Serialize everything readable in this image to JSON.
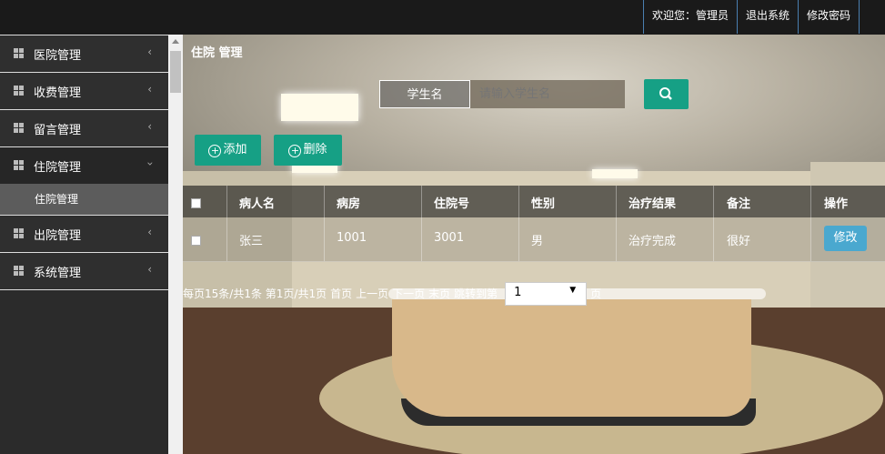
{
  "header": {
    "welcome": "欢迎您：管理员",
    "logout": "退出系统",
    "change_password": "修改密码"
  },
  "sidebar": {
    "items": [
      {
        "label": "医院管理",
        "expanded": false
      },
      {
        "label": "收费管理",
        "expanded": false
      },
      {
        "label": "留言管理",
        "expanded": false
      },
      {
        "label": "住院管理",
        "expanded": true,
        "children": [
          {
            "label": "住院管理"
          }
        ]
      },
      {
        "label": "出院管理",
        "expanded": false
      },
      {
        "label": "系统管理",
        "expanded": false
      }
    ]
  },
  "main": {
    "title": "住院 管理",
    "search": {
      "label": "学生名",
      "placeholder": "请输入学生名",
      "button_icon": "search-icon"
    },
    "actions": {
      "add": "添加",
      "delete": "删除"
    },
    "table": {
      "columns": [
        "病人名",
        "病房",
        "住院号",
        "性别",
        "治疗结果",
        "备注",
        "操作"
      ],
      "rows": [
        {
          "name": "张三",
          "ward": "1001",
          "admission_no": "3001",
          "gender": "男",
          "result": "治疗完成",
          "note": "很好",
          "action": "修改"
        }
      ]
    },
    "pager": {
      "summary": "每页15条/共1条 第1页/共1页",
      "first": "首页",
      "prev": "上一页",
      "next": "下一页",
      "last": "末页",
      "jump_prefix": "跳转到第",
      "jump_value": "1",
      "jump_suffix": "页"
    }
  },
  "colors": {
    "accent": "#16a085",
    "edit_button": "#4aa8cf",
    "topbar": "#1a1a1a",
    "sidebar": "#2f2f2f"
  }
}
